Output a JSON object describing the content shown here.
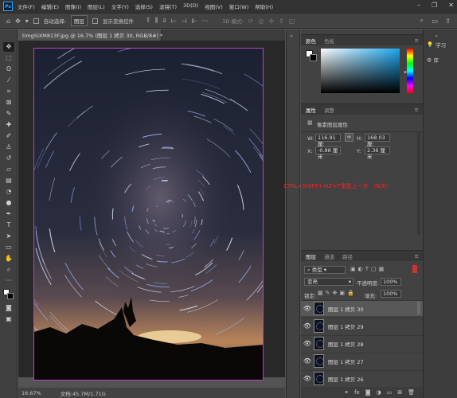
{
  "menu": [
    "文件(F)",
    "编辑(E)",
    "图像(I)",
    "图层(L)",
    "文字(Y)",
    "选择(S)",
    "滤镜(T)",
    "3D(D)",
    "视图(V)",
    "窗口(W)",
    "帮助(H)"
  ],
  "options": {
    "auto_select": "自动选择:",
    "layer_dropdown": "图层",
    "show_transform": "显示变换控件",
    "mode_3d": "3D 模式:"
  },
  "document": {
    "tab_title": "timgSIXM813F.jpg @ 16.7% (图层 1 拷贝 30, RGB/8#) *",
    "zoom": "16.67%",
    "doc_size": "文档:45.7M/1.71G"
  },
  "color_panel": {
    "tabs": [
      "颜色",
      "色板"
    ],
    "hue_color": "#1ba6ee"
  },
  "properties_panel": {
    "tabs": [
      "属性",
      "调整"
    ],
    "subtitle": "像素图层属性",
    "w_label": "W:",
    "w_value": "116.91 厘:",
    "h_label": "H:",
    "h_value": "168.03 厘:",
    "x_label": "X:",
    "x_value": "-0.88 厘米",
    "y_label": "Y:",
    "y_value": "2.36 厘米"
  },
  "annotation": "CTRL+SHIFT+ALT+T重复上一步 （N次）",
  "learn": {
    "learn_label": "学习",
    "library_label": "库"
  },
  "layers_panel": {
    "tabs": [
      "图层",
      "通道",
      "路径"
    ],
    "kind": "类型",
    "blend_mode": "变亮",
    "opacity_label": "不透明度:",
    "opacity_value": "100%",
    "lock_label": "锁定:",
    "fill_label": "填充:",
    "fill_value": "100%",
    "layers": [
      "图层 1 拷贝 30",
      "图层 1 拷贝 29",
      "图层 1 拷贝 28",
      "图层 1 拷贝 27",
      "图层 1 拷贝 26"
    ],
    "footer_icons": [
      "link-icon",
      "fx-icon",
      "mask-icon",
      "adjustment-icon",
      "group-icon",
      "new-layer-icon",
      "trash-icon"
    ]
  }
}
